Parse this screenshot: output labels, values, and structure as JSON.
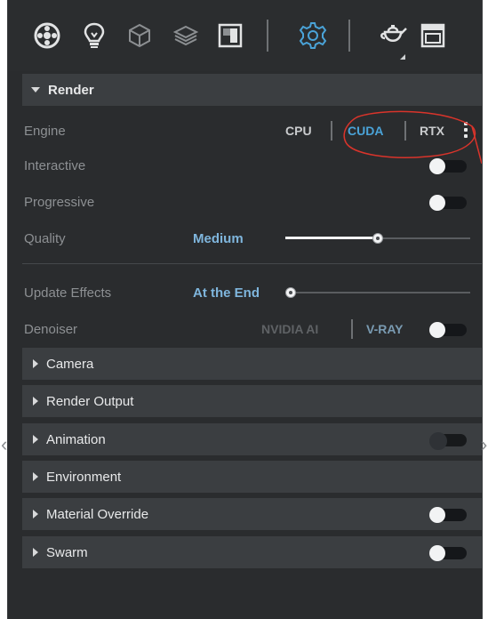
{
  "toolbar": {
    "icons": [
      "settings-wheel-icon",
      "lightbulb-icon",
      "cube-icon",
      "layers-icon",
      "texture-icon",
      "gear-icon",
      "teapot-icon",
      "frame-buffer-icon"
    ],
    "accent": "#4aa3d8"
  },
  "render": {
    "title": "Render",
    "engine_label": "Engine",
    "engine_options": [
      "CPU",
      "CUDA",
      "RTX"
    ],
    "engine_selected": "CUDA",
    "interactive_label": "Interactive",
    "interactive_on": false,
    "progressive_label": "Progressive",
    "progressive_on": false,
    "quality_label": "Quality",
    "quality_value": "Medium",
    "quality_level": 0.5,
    "update_effects_label": "Update Effects",
    "update_effects_value": "At the End",
    "update_effects_level": 0.0,
    "denoiser_label": "Denoiser",
    "denoiser_options": [
      "NVIDIA AI",
      "V-RAY"
    ],
    "denoiser_on": false
  },
  "sections": [
    {
      "label": "Camera",
      "has_toggle": false
    },
    {
      "label": "Render Output",
      "has_toggle": false
    },
    {
      "label": "Animation",
      "has_toggle": true,
      "toggle_on": false
    },
    {
      "label": "Environment",
      "has_toggle": false
    },
    {
      "label": "Material Override",
      "has_toggle": true,
      "toggle_on": false
    },
    {
      "label": "Swarm",
      "has_toggle": true,
      "toggle_on": false
    }
  ],
  "colors": {
    "annotation_circle": "#d9342b",
    "selected_option": "#4aa3d8",
    "unselected_option": "#c9cbcd",
    "value_text": "#7fb6dd"
  }
}
